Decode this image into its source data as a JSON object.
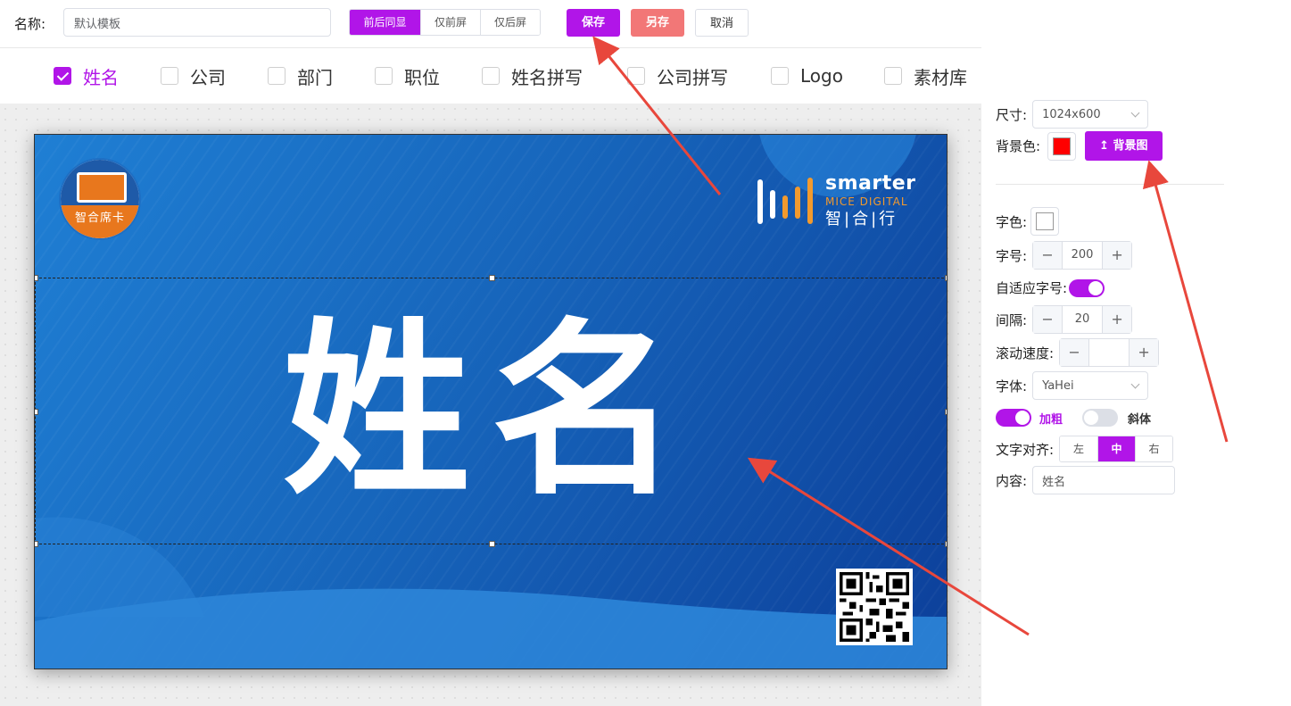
{
  "toolbar": {
    "name_label": "名称:",
    "name_value": "默认模板",
    "display_modes": [
      {
        "label": "前后同显",
        "active": true
      },
      {
        "label": "仅前屏",
        "active": false
      },
      {
        "label": "仅后屏",
        "active": false
      }
    ],
    "save_label": "保存",
    "save_as_label": "另存",
    "cancel_label": "取消"
  },
  "fields": [
    {
      "label": "姓名",
      "checked": true
    },
    {
      "label": "公司",
      "checked": false
    },
    {
      "label": "部门",
      "checked": false
    },
    {
      "label": "职位",
      "checked": false
    },
    {
      "label": "姓名拼写",
      "checked": false
    },
    {
      "label": "公司拼写",
      "checked": false
    },
    {
      "label": "Logo",
      "checked": false
    },
    {
      "label": "素材库",
      "checked": false
    }
  ],
  "card": {
    "name_text": "姓名",
    "logo_left_text": "智合席卡",
    "brand_name": "smarter",
    "brand_sub": "MICE DIGITAL",
    "brand_cn": "智|合|行",
    "colors": {
      "bg_start": "#1f7fd4",
      "bg_end": "#0c3f9a",
      "accent_orange": "#e8771d"
    }
  },
  "panel": {
    "size_label": "尺寸:",
    "size_value": "1024x600",
    "bg_color_label": "背景色:",
    "bg_color": "#ff0000",
    "bg_image_label": "背景图",
    "font_color_label": "字色:",
    "font_size_label": "字号:",
    "font_size_value": "200",
    "auto_size_label": "自适应字号:",
    "auto_size_on": true,
    "spacing_label": "间隔:",
    "spacing_value": "20",
    "scroll_speed_label": "滚动速度:",
    "scroll_speed_value": "",
    "font_label": "字体:",
    "font_value": "YaHei",
    "bold_label": "加粗",
    "bold_on": true,
    "italic_label": "斜体",
    "italic_on": false,
    "align_label": "文字对齐:",
    "align_options": [
      {
        "label": "左",
        "active": false
      },
      {
        "label": "中",
        "active": true
      },
      {
        "label": "右",
        "active": false
      }
    ],
    "content_label": "内容:",
    "content_value": "姓名"
  },
  "colors": {
    "accent": "#b115e8",
    "save_as": "#f27777",
    "annotation_arrow": "#e8473c"
  }
}
